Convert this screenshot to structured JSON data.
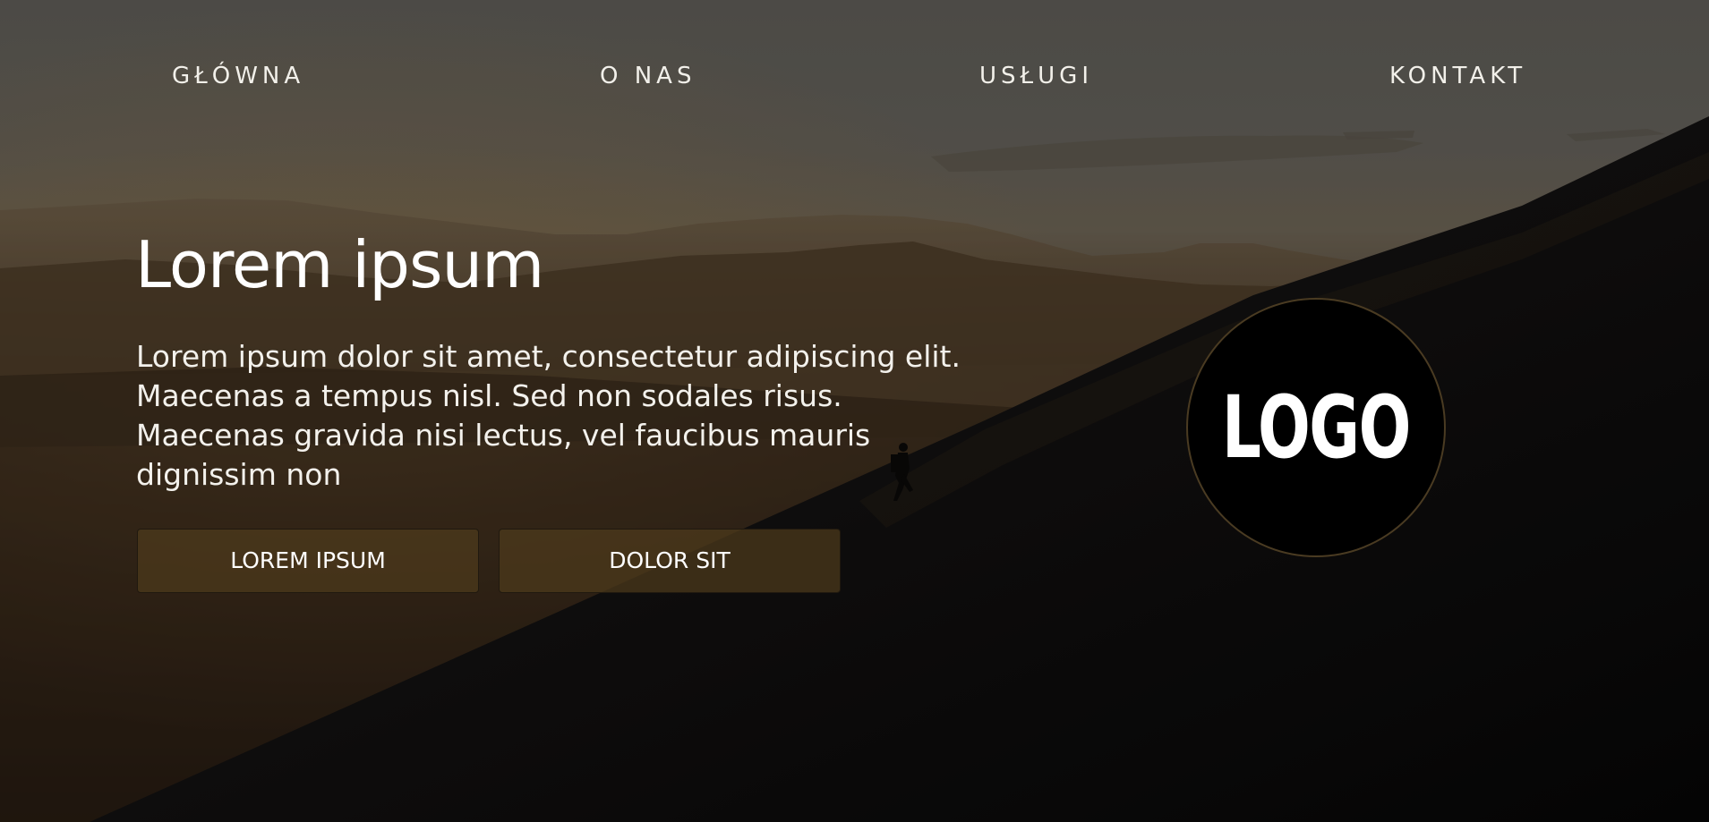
{
  "nav": {
    "items": [
      {
        "label": "GŁÓWNA"
      },
      {
        "label": "O NAS"
      },
      {
        "label": "USŁUGI"
      },
      {
        "label": "KONTAKT"
      }
    ]
  },
  "hero": {
    "title": "Lorem ipsum",
    "text": "Lorem ipsum dolor sit amet, consectetur adipiscing elit. Maecenas a tempus nisl. Sed non sodales risus. Maecenas gravida nisi lectus, vel faucibus mauris dignissim non",
    "buttons": [
      {
        "label": "LOREM IPSUM"
      },
      {
        "label": "DOLOR SIT"
      }
    ]
  },
  "logo": {
    "text": "LOGO"
  },
  "colors": {
    "text": "#ffffff",
    "button_fill": "#4e3a1c",
    "logo_ring": "#4a3b22"
  },
  "icons": {
    "background": "mountain-landscape-with-hiker-photo"
  }
}
